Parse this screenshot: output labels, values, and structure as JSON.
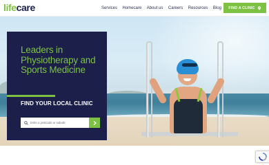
{
  "brand": {
    "part1": "life",
    "part2": "care",
    "colors": {
      "green": "#7dc242",
      "navy": "#1c1f4a"
    }
  },
  "nav": {
    "items": [
      "Services",
      "Homecare",
      "About us",
      "Careers",
      "Resources",
      "Blog"
    ],
    "cta_label": "FIND A CLINIC",
    "cta_icon": "location-pin-icon"
  },
  "hero": {
    "headline": "Leaders in Physiotherapy and Sports Medicine",
    "subhead": "FIND YOUR LOCAL CLINIC",
    "search_placeholder": "Enter a postcode or suburb",
    "search_icon": "search-icon",
    "submit_icon": "chevron-right-icon",
    "image": "swimmer-at-pool-ladder-photo"
  },
  "recaptcha": {
    "icon": "recaptcha-icon"
  }
}
